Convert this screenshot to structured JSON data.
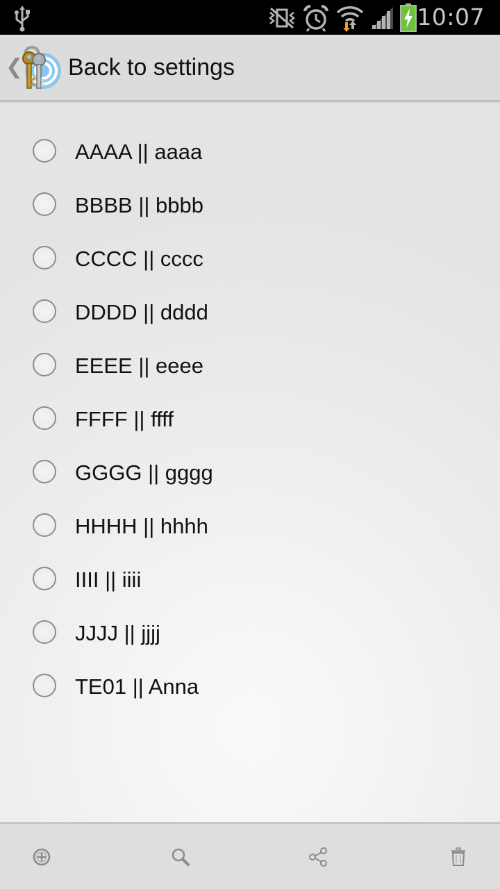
{
  "status_bar": {
    "time": "10:07",
    "icons": [
      "usb-icon",
      "mute-vibrate-icon",
      "alarm-icon",
      "wifi-icon",
      "signal-icon",
      "battery-charging-icon"
    ]
  },
  "action_bar": {
    "up_caret": "❮",
    "title": "Back to settings",
    "app_icon": "keys-icon"
  },
  "list": {
    "items": [
      {
        "label": "AAAA || aaaa",
        "selected": false
      },
      {
        "label": "BBBB || bbbb",
        "selected": false
      },
      {
        "label": "CCCC || cccc",
        "selected": false
      },
      {
        "label": "DDDD || dddd",
        "selected": false
      },
      {
        "label": "EEEE || eeee",
        "selected": false
      },
      {
        "label": "FFFF || ffff",
        "selected": false
      },
      {
        "label": "GGGG || gggg",
        "selected": false
      },
      {
        "label": "HHHH || hhhh",
        "selected": false
      },
      {
        "label": "IIII || iiii",
        "selected": false
      },
      {
        "label": "JJJJ || jjjj",
        "selected": false
      },
      {
        "label": "TE01 || Anna",
        "selected": false
      }
    ]
  },
  "bottom_bar": {
    "buttons": [
      "add-icon",
      "search-icon",
      "share-icon",
      "delete-icon"
    ]
  }
}
